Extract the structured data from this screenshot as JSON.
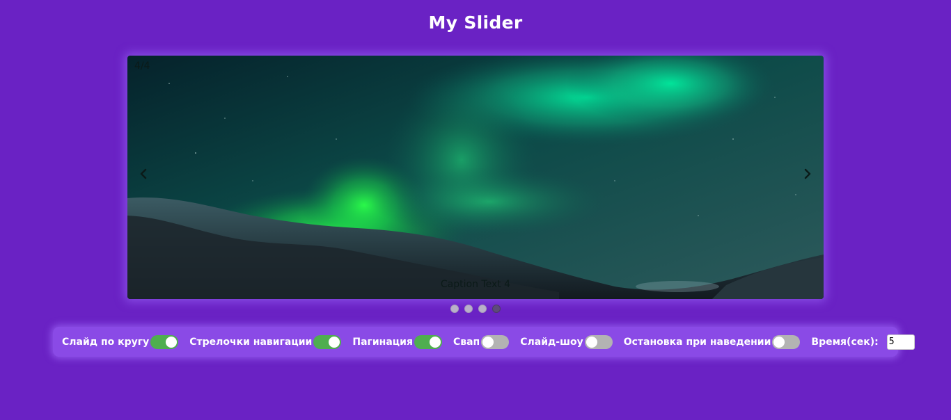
{
  "page": {
    "title": "My Slider"
  },
  "slider": {
    "counter": "4/4",
    "caption": "Caption Text 4",
    "image_icon": "aurora-landscape-image",
    "prev_icon": "chevron-left-icon",
    "next_icon": "chevron-right-icon",
    "dots": [
      {
        "active": false
      },
      {
        "active": false
      },
      {
        "active": false
      },
      {
        "active": true
      }
    ]
  },
  "controls": {
    "loop": {
      "label": "Слайд по кругу",
      "on": true
    },
    "arrows": {
      "label": "Стрелочки навигации",
      "on": true
    },
    "pagination": {
      "label": "Пагинация",
      "on": true
    },
    "swipe": {
      "label": "Свап",
      "on": false
    },
    "slideshow": {
      "label": "Слайд-шоу",
      "on": false
    },
    "pause_on_hover": {
      "label": "Остановка при наведении",
      "on": false
    },
    "time": {
      "label": "Время(сек):",
      "value": "5"
    }
  },
  "colors": {
    "background": "#6a22c4",
    "panel": "#8a4ae6",
    "toggle_on": "#4fae4f",
    "toggle_off": "#b3b3b3"
  }
}
